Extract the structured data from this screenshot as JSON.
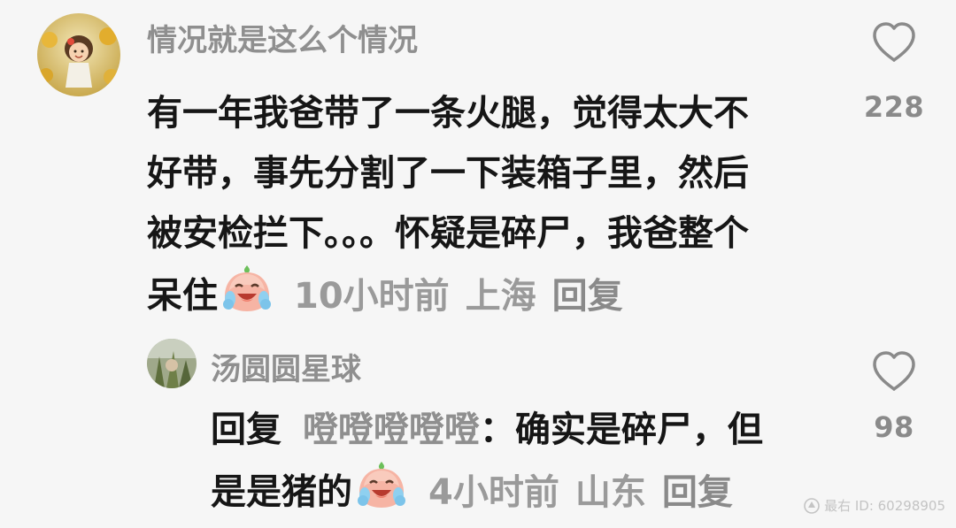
{
  "comment": {
    "username": "情况就是这么个情况",
    "lines": [
      "有一年我爸带了一条火腿，觉得太大不",
      "好带，事先分割了一下装箱子里，然后",
      "被安检拦下。。。怀疑是碎尸，我爸整个",
      "呆住"
    ],
    "emoji": "crying-laughing-peach-emoji",
    "time": "10小时前",
    "location": "上海",
    "reply_label": "回复",
    "likes": "228"
  },
  "reply": {
    "username": "汤圆圆星球",
    "prefix": "回复",
    "target": "噔噔噔噔噔",
    "lines": [
      "：确实是碎尸，但",
      "是是猪的"
    ],
    "emoji": "crying-laughing-peach-emoji",
    "time": "4小时前",
    "location": "山东",
    "reply_label": "回复",
    "likes": "98"
  },
  "watermark": "最右 ID: 60298905",
  "colors": {
    "background": "#f6f6f6",
    "text": "#161616",
    "muted": "#8f8f8f"
  }
}
